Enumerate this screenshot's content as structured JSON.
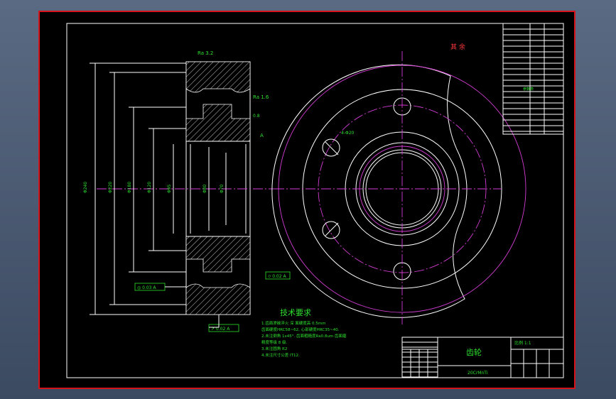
{
  "drawing": {
    "title": "齿轮",
    "material": "20CrMnTi",
    "tech_requirements_title": "技术要求",
    "tech_requirements": [
      "1.齿面渗碳淬火 深 面硬度高 0.5mm",
      "齿面硬度HRC58~62, 心部硬度HRC35~40.",
      "2.未注倒角 1x45°. 齿面粗糙度Ra0.8um 齿面磨",
      "精度等级 8 级.",
      "3.未注圆角 R2",
      "4.未注尺寸公差 IT12."
    ]
  },
  "annotations": {
    "roughness_top": "Ra 3.2",
    "roughness_right": "Ra 1.6",
    "roughness_label": "0.8",
    "tolerance_box_1": "◎ 0.03 A",
    "tolerance_box_2": "⌭ 0.02 A",
    "tolerance_box_3": "↗ 0.02 A",
    "datum_label": "A",
    "hole_note": "4-Φ20",
    "corner_note": "其 余"
  },
  "dimensions": {
    "d1": "Φ240",
    "d2": "Φ220",
    "d3": "Φ180",
    "d4": "Φ120",
    "d5": "Φ95",
    "d6": "Φ80",
    "d7": "Φ70"
  },
  "title_block": {
    "params_header": "参数表",
    "scale_note": "比例 1:1"
  }
}
